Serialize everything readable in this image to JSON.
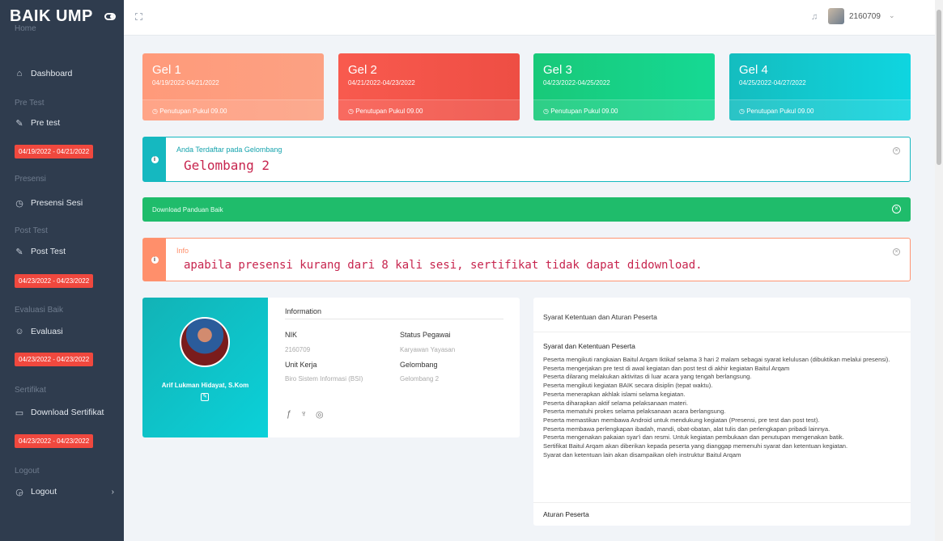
{
  "brand": {
    "title": "BAIK UMP"
  },
  "topbar": {
    "user_id": "2160709"
  },
  "sidebar": {
    "sections": [
      {
        "heading": "Home",
        "item": "Dashboard",
        "icon": "home-icon",
        "badge": ""
      },
      {
        "heading": "Pre Test",
        "item": "Pre test",
        "icon": "pen-icon",
        "badge": "04/19/2022 - 04/21/2022"
      },
      {
        "heading": "Presensi",
        "item": "Presensi Sesi",
        "icon": "clock-icon",
        "badge": ""
      },
      {
        "heading": "Post Test",
        "item": "Post Test",
        "icon": "pen-icon",
        "badge": "04/23/2022 - 04/23/2022"
      },
      {
        "heading": "Evaluasi Baik",
        "item": "Evaluasi",
        "icon": "evaluate-icon",
        "badge": "04/23/2022 - 04/23/2022"
      },
      {
        "heading": "Sertifikat",
        "item": "Download Sertifikat",
        "icon": "monitor-icon",
        "badge": "04/23/2022 - 04/23/2022"
      },
      {
        "heading": "Logout",
        "item": "Logout",
        "icon": "logout-icon",
        "badge": ""
      }
    ]
  },
  "gel_cards": [
    {
      "title": "Gel 1",
      "date": "04/19/2022-04/21/2022",
      "footer": "Penutupan Pukul 09.00",
      "color": "#fca183"
    },
    {
      "title": "Gel 2",
      "date": "04/21/2022-04/23/2022",
      "footer": "Penutupan Pukul 09.00",
      "color": "#ee4e44"
    },
    {
      "title": "Gel 3",
      "date": "04/23/2022-04/25/2022",
      "footer": "Penutupan Pukul 09.00",
      "color": "#16d994"
    },
    {
      "title": "Gel 4",
      "date": "04/25/2022-04/27/2022",
      "footer": "Penutupan Pukul 09.00",
      "color": "#0fd5e0"
    }
  ],
  "alerts": {
    "registered": {
      "label": "Anda Terdaftar pada Gelombang",
      "value": "Gelombang 2"
    },
    "download": {
      "label": "Download Panduan Baik"
    },
    "info": {
      "label": "Info",
      "value": "apabila presensi kurang dari 8 kali sesi, sertifikat tidak dapat didownload."
    }
  },
  "profile": {
    "name": "Arif Lukman Hidayat, S.Kom",
    "heading": "Information",
    "nik_label": "NIK",
    "nik_value": "2160709",
    "status_label": "Status Pegawai",
    "status_value": "Karyawan Yayasan",
    "unit_label": "Unit Kerja",
    "unit_value": "Biro Sistem Informasi (BSI)",
    "gelombang_label": "Gelombang",
    "gelombang_value": "Gelombang 2"
  },
  "terms": {
    "heading": "Syarat Ketentuan dan Aturan Peserta",
    "subheading": "Syarat dan Ketentuan Peserta",
    "items": [
      "Peserta mengikuti rangkaian Baitul Arqam Iktikaf selama 3 hari 2 malam sebagai syarat kelulusan (dibuktikan melalui presensi).",
      "Peserta mengerjakan pre test di awal kegiatan dan post test di akhir kegiatan Baitul Arqam",
      "Peserta dilarang melakukan aktivitas di luar acara yang tengah berlangsung.",
      "Peserta mengikuti kegiatan BAIK secara disiplin (tepat waktu).",
      "Peserta menerapkan akhlak islami selama kegiatan.",
      "Peserta diharapkan aktif selama pelaksanaan materi.",
      "Peserta mematuhi prokes selama pelaksanaan acara berlangsung.",
      "Peserta memastikan membawa Android untuk mendukung kegiatan (Presensi, pre test dan post test).",
      "Peserta membawa perlengkapan ibadah, mandi, obat-obatan, alat tulis dan perlengkapan pribadi lainnya.",
      "Peserta mengenakan pakaian syar'i dan resmi. Untuk kegiatan pembukaan dan penutupan mengenakan batik.",
      "Sertifikat Baitul Arqam akan diberikan kepada peserta yang dianggap memenuhi syarat dan ketentuan kegiatan.",
      "Syarat dan ketentuan lain akan disampaikan oleh instruktur Baitul Arqam"
    ],
    "subheading2": "Aturan Peserta"
  }
}
